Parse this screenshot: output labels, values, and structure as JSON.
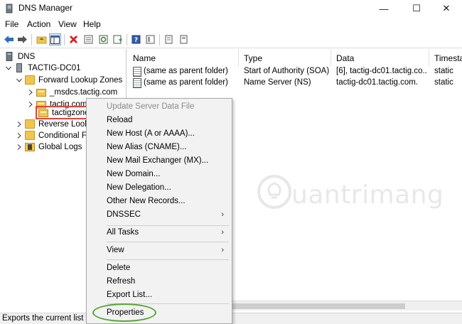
{
  "window": {
    "title": "DNS Manager",
    "icon": "dns-manager-icon",
    "controls": {
      "minimize": "—",
      "maximize": "☐",
      "close": "✕"
    }
  },
  "menubar": {
    "items": [
      "File",
      "Action",
      "View",
      "Help"
    ]
  },
  "toolbar": {
    "buttons": [
      "back-icon",
      "forward-icon",
      "up-folder-icon",
      "show-tree-icon",
      "delete-icon",
      "properties-sheet-icon",
      "refresh-icon",
      "export-list-icon",
      "help-icon",
      "details-view-icon",
      "list-view-icon",
      "large-icons-icon"
    ]
  },
  "tree": {
    "root": "DNS",
    "server": "TACTIG-DC01",
    "forward_zones": "Forward Lookup Zones",
    "zones": [
      "_msdcs.tactig.com",
      "tactig.com",
      "tactigzone"
    ],
    "reverse_zones": "Reverse Looku",
    "conditional": "Conditional Fo",
    "global_logs": "Global Logs"
  },
  "list": {
    "columns": [
      "Name",
      "Type",
      "Data",
      "Timesta"
    ],
    "rows": [
      {
        "name": "(same as parent folder)",
        "type": "Start of Authority (SOA)",
        "data": "[6], tactig-dc01.tactig.co...",
        "timestamp": "static"
      },
      {
        "name": "(same as parent folder)",
        "type": "Name Server (NS)",
        "data": "tactig-dc01.tactig.com.",
        "timestamp": "static"
      }
    ]
  },
  "context_menu": {
    "items": [
      {
        "label": "Update Server Data File",
        "disabled": true
      },
      {
        "label": "Reload"
      },
      {
        "label": "New Host (A or AAAA)..."
      },
      {
        "label": "New Alias (CNAME)..."
      },
      {
        "label": "New Mail Exchanger (MX)..."
      },
      {
        "label": "New Domain..."
      },
      {
        "label": "New Delegation..."
      },
      {
        "label": "Other New Records..."
      },
      {
        "label": "DNSSEC",
        "submenu": true
      },
      {
        "label": "All Tasks",
        "submenu": true
      },
      {
        "label": "View",
        "submenu": true
      },
      {
        "label": "Delete"
      },
      {
        "label": "Refresh"
      },
      {
        "label": "Export List..."
      },
      {
        "label": "Properties",
        "highlighted": true
      }
    ],
    "submenu_arrow": "›"
  },
  "statusbar": {
    "text": "Exports the current list to a"
  },
  "watermark": {
    "text": "uantrimang",
    "icon": "lightbulb-logo-icon"
  },
  "colors": {
    "selection_box": "#e0443a",
    "properties_oval": "#55a630",
    "folder": "#f2c54e"
  }
}
